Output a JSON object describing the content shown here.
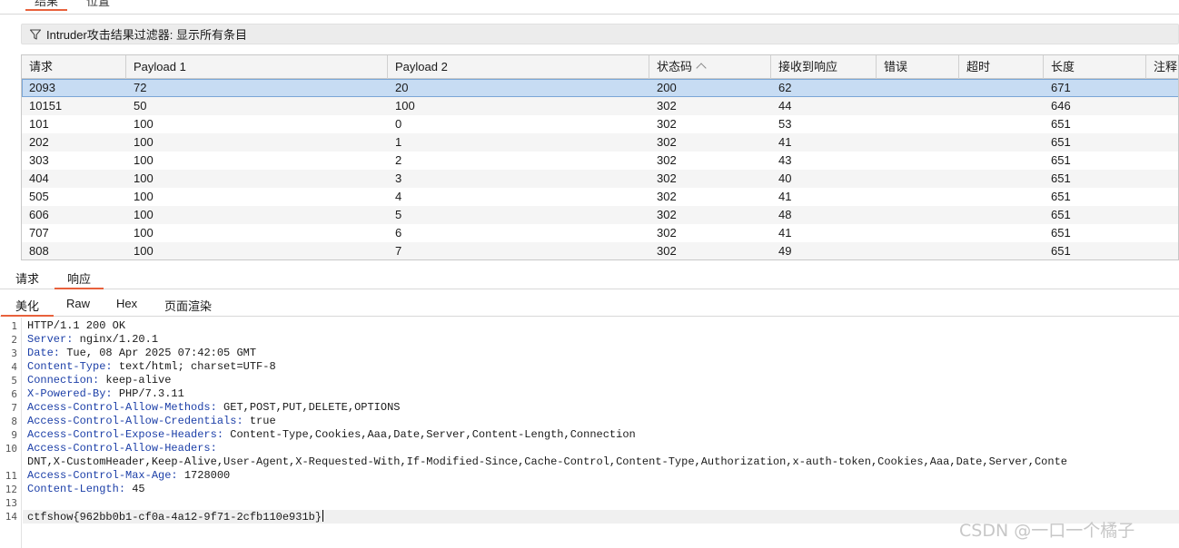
{
  "top_tabs": [
    "结果",
    "位置"
  ],
  "filter": {
    "label": "Intruder攻击结果过滤器: 显示所有条目"
  },
  "table": {
    "columns": [
      "请求",
      "Payload 1",
      "Payload 2",
      "状态码",
      "接收到响应",
      "错误",
      "超时",
      "长度",
      "注释"
    ],
    "rows": [
      [
        "2093",
        "72",
        "20",
        "200",
        "62",
        "",
        "",
        "671",
        ""
      ],
      [
        "10151",
        "50",
        "100",
        "302",
        "44",
        "",
        "",
        "646",
        ""
      ],
      [
        "101",
        "100",
        "0",
        "302",
        "53",
        "",
        "",
        "651",
        ""
      ],
      [
        "202",
        "100",
        "1",
        "302",
        "41",
        "",
        "",
        "651",
        ""
      ],
      [
        "303",
        "100",
        "2",
        "302",
        "43",
        "",
        "",
        "651",
        ""
      ],
      [
        "404",
        "100",
        "3",
        "302",
        "40",
        "",
        "",
        "651",
        ""
      ],
      [
        "505",
        "100",
        "4",
        "302",
        "41",
        "",
        "",
        "651",
        ""
      ],
      [
        "606",
        "100",
        "5",
        "302",
        "48",
        "",
        "",
        "651",
        ""
      ],
      [
        "707",
        "100",
        "6",
        "302",
        "41",
        "",
        "",
        "651",
        ""
      ],
      [
        "808",
        "100",
        "7",
        "302",
        "49",
        "",
        "",
        "651",
        ""
      ]
    ],
    "selected_row": 0,
    "sorted_column": "状态码"
  },
  "rr_tabs": {
    "request": "请求",
    "response": "响应"
  },
  "view_tabs": [
    "美化",
    "Raw",
    "Hex",
    "页面渲染"
  ],
  "response": {
    "lines": [
      {
        "n": "1",
        "key": "",
        "value": "HTTP/1.1 200 OK"
      },
      {
        "n": "2",
        "key": "Server:",
        "value": " nginx/1.20.1"
      },
      {
        "n": "3",
        "key": "Date:",
        "value": " Tue, 08 Apr 2025 07:42:05 GMT"
      },
      {
        "n": "4",
        "key": "Content-Type:",
        "value": " text/html; charset=UTF-8"
      },
      {
        "n": "5",
        "key": "Connection:",
        "value": " keep-alive"
      },
      {
        "n": "6",
        "key": "X-Powered-By:",
        "value": " PHP/7.3.11"
      },
      {
        "n": "7",
        "key": "Access-Control-Allow-Methods:",
        "value": " GET,POST,PUT,DELETE,OPTIONS"
      },
      {
        "n": "8",
        "key": "Access-Control-Allow-Credentials:",
        "value": " true"
      },
      {
        "n": "9",
        "key": "Access-Control-Expose-Headers:",
        "value": " Content-Type,Cookies,Aaa,Date,Server,Content-Length,Connection"
      },
      {
        "n": "10",
        "key": "Access-Control-Allow-Headers:",
        "value": ""
      },
      {
        "n": "",
        "key": "",
        "value": "DNT,X-CustomHeader,Keep-Alive,User-Agent,X-Requested-With,If-Modified-Since,Cache-Control,Content-Type,Authorization,x-auth-token,Cookies,Aaa,Date,Server,Conte"
      },
      {
        "n": "11",
        "key": "Access-Control-Max-Age:",
        "value": " 1728000"
      },
      {
        "n": "12",
        "key": "Content-Length:",
        "value": " 45"
      },
      {
        "n": "13",
        "key": "",
        "value": ""
      },
      {
        "n": "14",
        "key": "",
        "value": "ctfshow{962bb0b1-cf0a-4a12-9f71-2cfb110e931b}"
      }
    ]
  },
  "watermark": "CSDN @一口一个橘子",
  "colors": {
    "accent": "#e8613c",
    "selected_row": "#c7dcf3",
    "header_key": "#1c3fa8"
  }
}
